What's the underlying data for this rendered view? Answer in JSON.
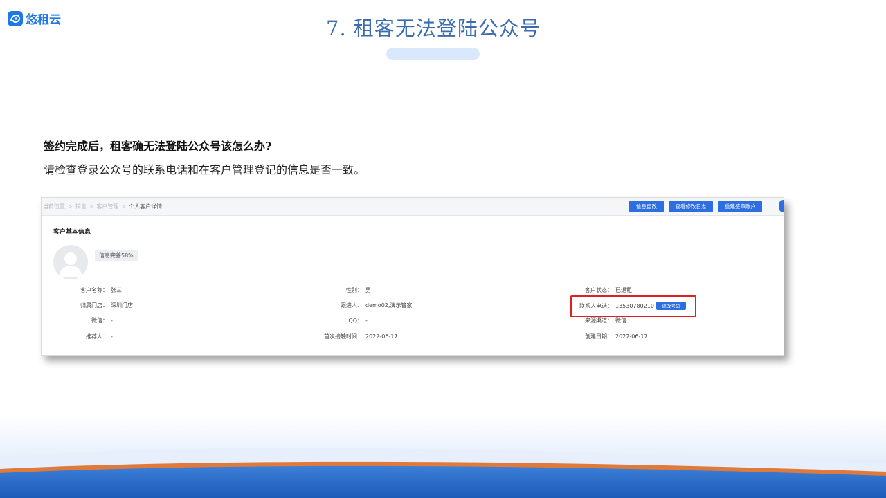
{
  "logo": {
    "text": "悠租云"
  },
  "slide": {
    "title": "7. 租客无法登陆公众号",
    "question": "签约完成后，租客确无法登陆公众号该怎么办?",
    "answer": "请检查登录公众号的联系电话和在客户管理登记的信息是否一致。"
  },
  "screenshot": {
    "breadcrumb": [
      "当前位置",
      "销售",
      "客户管理",
      "个人客户详情"
    ],
    "buttons": {
      "edit_info": "信息更改",
      "view_log": "查看修改日志",
      "rebuild_account": "重建签章账户"
    },
    "section_title": "客户基本信息",
    "completeness": "信息完善58%",
    "fields": {
      "name": {
        "label": "客户名称：",
        "value": "张三"
      },
      "gender": {
        "label": "性别：",
        "value": "男"
      },
      "status": {
        "label": "客户状态：",
        "value": "已退租"
      },
      "store": {
        "label": "归属门店：",
        "value": "深圳门店"
      },
      "follower": {
        "label": "跟进人：",
        "value": "demo02,演示管家"
      },
      "phone": {
        "label": "联系人电话：",
        "value": "13530780210",
        "button": "修改号码"
      },
      "wechat": {
        "label": "微信：",
        "value": "-"
      },
      "qq": {
        "label": "QQ：",
        "value": "-"
      },
      "channel": {
        "label": "来源渠道：",
        "value": "微信"
      },
      "referrer": {
        "label": "推荐人：",
        "value": "-"
      },
      "first_contact": {
        "label": "首次接触时间：",
        "value": "2022-06-17"
      },
      "created": {
        "label": "创建日期：",
        "value": "2022-06-17"
      }
    }
  }
}
